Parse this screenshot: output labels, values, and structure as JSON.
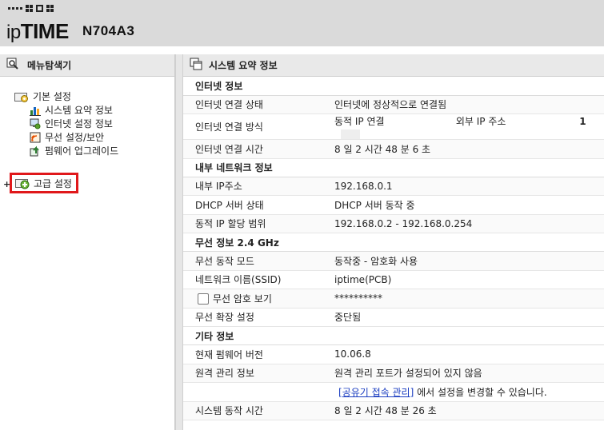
{
  "header": {
    "logo_prefix": "ip",
    "logo_bold": "TIME",
    "model": "N704A3"
  },
  "left_panel": {
    "title": "메뉴탐색기",
    "tree": {
      "basic": {
        "label": "기본 설정",
        "children": [
          "시스템 요약 정보",
          "인터넷 설정 정보",
          "무선 설정/보안",
          "펌웨어 업그레이드"
        ]
      },
      "advanced": {
        "label": "고급 설정",
        "expander": "+"
      }
    }
  },
  "right_panel": {
    "title": "시스템 요약 정보",
    "sections": {
      "internet": {
        "title": "인터넷 정보",
        "status_label": "인터넷 연결 상태",
        "status_value": "인터넷에 정상적으로 연결됨",
        "method_label": "인터넷 연결 방식",
        "method_value": "동적 IP 연결",
        "external_ip_label": "외부 IP 주소",
        "external_ip_value": "1",
        "time_label": "인터넷 연결 시간",
        "time_value": "8 일 2 시간 48 분 6 초"
      },
      "internal": {
        "title": "내부 네트워크 정보",
        "ip_label": "내부 IP주소",
        "ip_value": "192.168.0.1",
        "dhcp_label": "DHCP 서버 상태",
        "dhcp_value": "DHCP 서버 동작 중",
        "range_label": "동적 IP 할당 범위",
        "range_value": "192.168.0.2 -  192.168.0.254"
      },
      "wireless": {
        "title": "무선 정보 2.4 GHz",
        "mode_label": "무선 동작 모드",
        "mode_value": "동작중 - 암호화 사용",
        "ssid_label": "네트워크 이름(SSID)",
        "ssid_value": "iptime(PCB)",
        "show_pw_label": "무선 암호 보기",
        "pw_value": "**********",
        "ext_label": "무선 확장 설정",
        "ext_value": "중단됨"
      },
      "other": {
        "title": "기타 정보",
        "fw_label": "현재 펌웨어 버전",
        "fw_value": "10.06.8",
        "remote_label": "원격 관리 정보",
        "remote_value": "원격 관리 포트가 설정되어 있지 않음",
        "remote_link_open": "[",
        "remote_link": "공유기 접속 관리",
        "remote_link_close": "]",
        "remote_link_suffix": " 에서 설정을 변경할 수 있습니다.",
        "uptime_label": "시스템 동작 시간",
        "uptime_value": "8 일 2 시간 48 분 26 초"
      }
    }
  },
  "colors": {
    "highlight_border": "#e0181b",
    "link": "#1a3cc0",
    "panel_bg": "#e9e9e9",
    "header_bg": "#dadada"
  }
}
